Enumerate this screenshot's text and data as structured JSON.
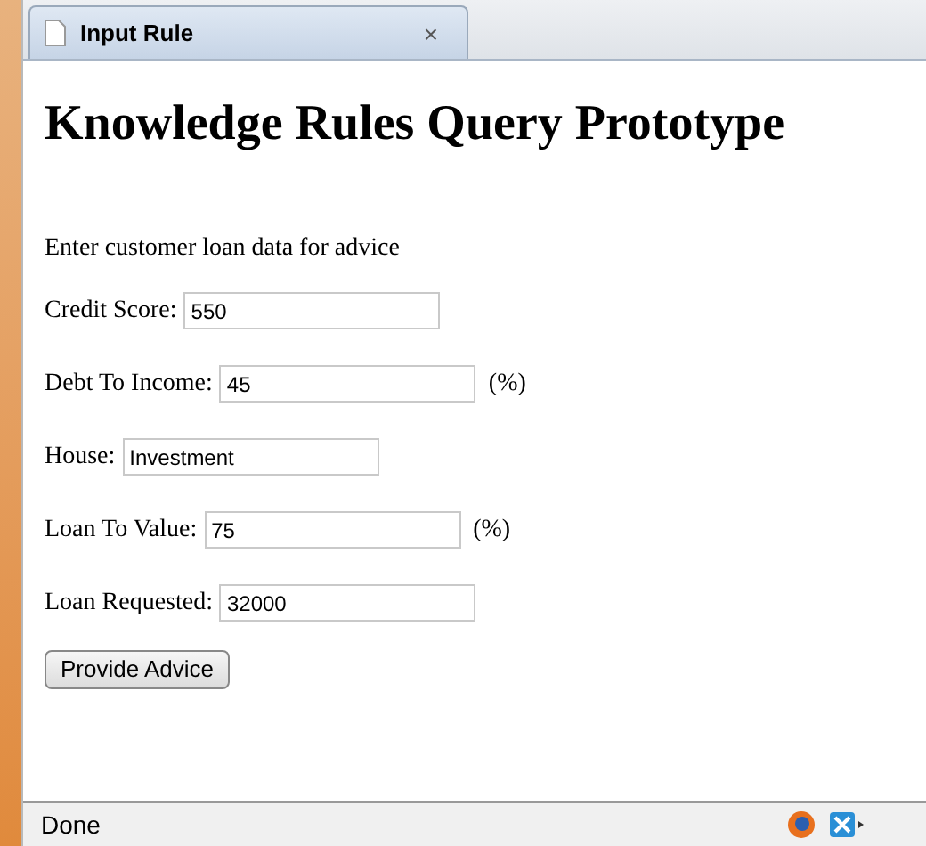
{
  "tab": {
    "title": "Input Rule",
    "close": "×",
    "selected": true
  },
  "heading": "Knowledge Rules Query Prototype",
  "intro": "Enter customer loan data for advice",
  "fields": [
    {
      "label": "Credit Score:",
      "value": "550"
    },
    {
      "label": "Debt To Income:",
      "value": "45",
      "suffix": "(%)"
    },
    {
      "label": "House:",
      "value": "Investment"
    },
    {
      "label": "Loan To Value:",
      "value": "75",
      "suffix": "(%)"
    },
    {
      "label": "Loan Requested:",
      "value": "32000"
    }
  ],
  "button": "Provide Advice",
  "status_bar": {
    "text": "Done"
  }
}
